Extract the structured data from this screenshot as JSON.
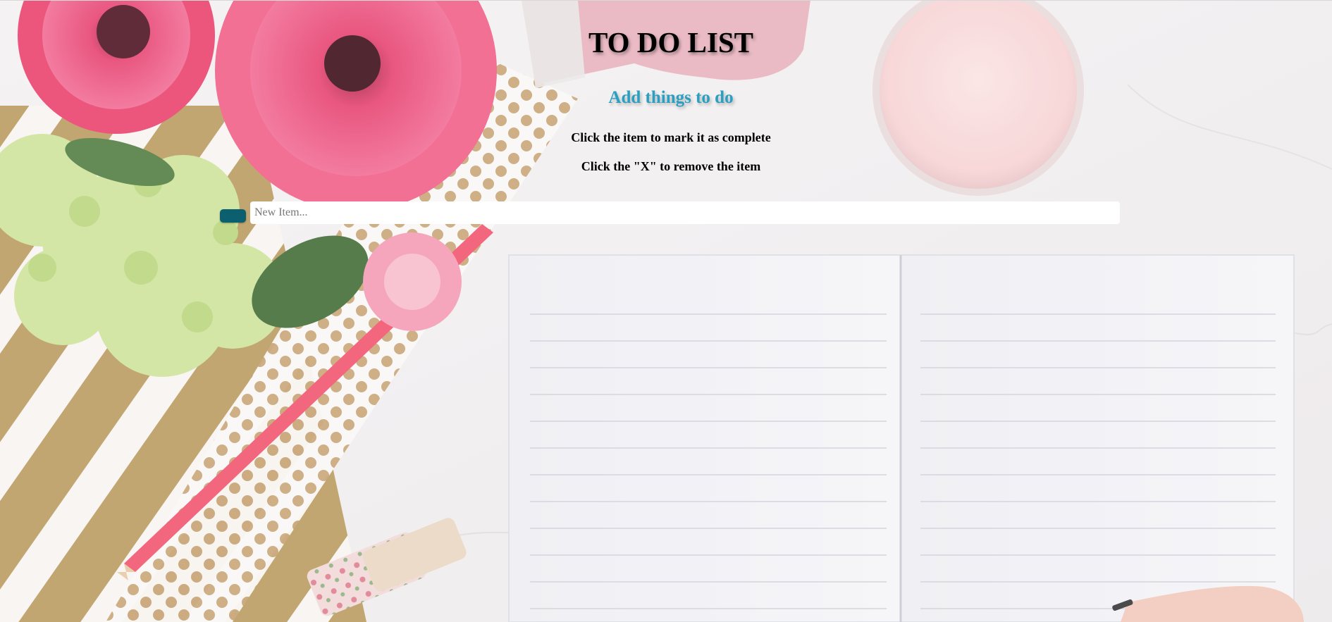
{
  "header": {
    "title": "TO DO LIST",
    "subtitle": "Add things to do",
    "instructions": [
      "Click the item to mark it as complete",
      "Click the \"X\" to remove the item"
    ]
  },
  "form": {
    "add_button_label": "",
    "input_placeholder": "New Item...",
    "input_value": ""
  },
  "colors": {
    "subtitle": "#2a9fc1",
    "add_button": "#0b5f6f",
    "input_background": "#ffffff"
  },
  "icons": {
    "background": "flat-lay-flowers-notebook-photo"
  }
}
